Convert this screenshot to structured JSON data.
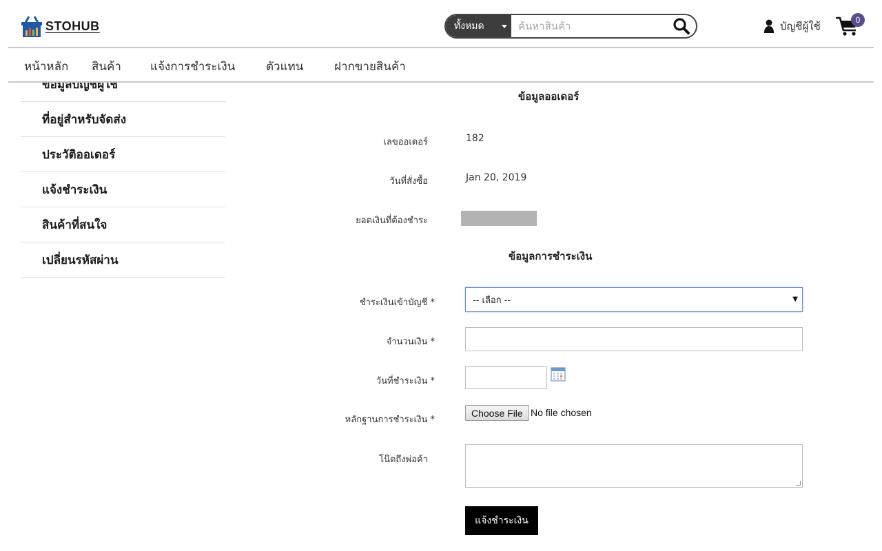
{
  "header": {
    "logo_text": "STOHUB",
    "search": {
      "category_label": "ทั้งหมด",
      "placeholder": "ค้นหาสินค้า"
    },
    "account_label": "บัญชีผู้ใช้",
    "cart_count": "0"
  },
  "nav": {
    "items": [
      {
        "label": "หน้าหลัก"
      },
      {
        "label": "สินค้า"
      },
      {
        "label": "แจ้งการชำระเงิน"
      },
      {
        "label": "ตัวแทน"
      },
      {
        "label": "ฝากขายสินค้า"
      }
    ]
  },
  "sidebar": {
    "items": [
      {
        "label": "ข้อมูลบัญชีผู้ใช้"
      },
      {
        "label": "ที่อยู่สำหรับจัดส่ง"
      },
      {
        "label": "ประวัติออเดอร์"
      },
      {
        "label": "แจ้งชำระเงิน"
      },
      {
        "label": "สินค้าที่สนใจ"
      },
      {
        "label": "เปลี่ยนรหัสผ่าน"
      }
    ]
  },
  "order_info": {
    "title": "ข้อมูลออเดอร์",
    "order_no_label": "เลขออเดอร์",
    "order_no": "182",
    "order_date_label": "วันที่สั่งซื้อ",
    "order_date": "Jan 20, 2019",
    "amount_due_label": "ยอดเงินที่ต้องชำระ"
  },
  "payment_info": {
    "title": "ข้อมูลการชำระเงิน",
    "account_label": "ชำระเงินเข้าบัญชี *",
    "account_selected": "-- เลือก --",
    "amount_label": "จำนวนเงิน *",
    "date_label": "วันที่ชำระเงิน *",
    "proof_label": "หลักฐานการชำระเงิน *",
    "file_button": "Choose File",
    "file_status": "No file chosen",
    "note_label": "โน๊ตถึงพ่อค้า",
    "submit_label": "แจ้งชำระเงิน"
  },
  "colors": {
    "badge": "#5b4a8e",
    "submit_bg": "#000000",
    "search_category_bg": "#3d3d3d"
  }
}
